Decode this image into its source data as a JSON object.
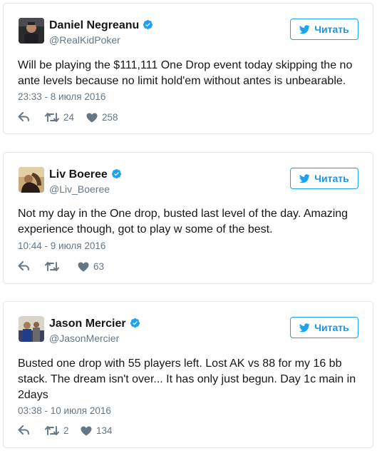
{
  "follow_label": "Читать",
  "tweets": [
    {
      "name": "Daniel Negreanu",
      "handle": "@RealKidPoker",
      "text": "Will be playing the $111,111 One Drop event today skipping the no ante levels because no limit hold'em without antes is unbearable.",
      "timestamp": "23:33 - 8 июля 2016",
      "retweets": "24",
      "likes": "258"
    },
    {
      "name": "Liv Boeree",
      "handle": "@Liv_Boeree",
      "text": "Not my day in the One drop, busted last level of the day. Amazing experience though, got to play w some of the best.",
      "timestamp": "10:44 - 9 июля 2016",
      "retweets": "",
      "likes": "63"
    },
    {
      "name": "Jason Mercier",
      "handle": "@JasonMercier",
      "text": "Busted one drop with 55 players left. Lost AK vs 88 for my 16 bb stack. The dream isn't over... It has only just begun. Day 1c main in 2days",
      "timestamp": "03:38 - 10 июля 2016",
      "retweets": "2",
      "likes": "134"
    }
  ],
  "colors": {
    "accent": "#1da1f2",
    "follow_text": "#1b95e0",
    "meta": "#657786",
    "border": "#e1e8ed",
    "verified": "#1da1f2"
  },
  "icons": {
    "verified": "verified-badge-icon",
    "twitter": "twitter-bird-icon",
    "reply": "reply-icon",
    "retweet": "retweet-icon",
    "like": "heart-icon"
  }
}
